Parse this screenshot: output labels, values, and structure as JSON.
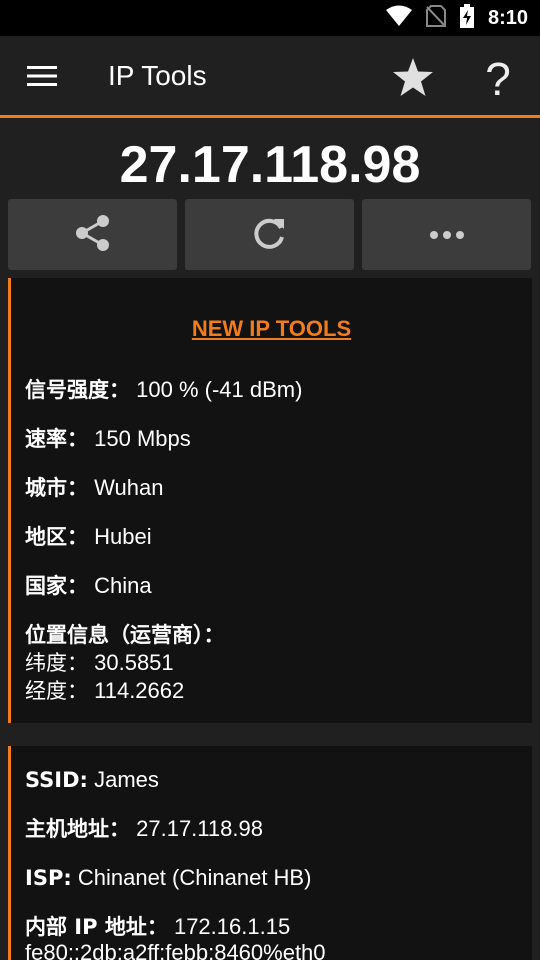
{
  "status_bar": {
    "time": "8:10",
    "icons": [
      "wifi-icon",
      "no-sim-icon",
      "battery-charging-icon"
    ]
  },
  "app_bar": {
    "title": "IP Tools",
    "help_glyph": "?",
    "icons": [
      "menu-icon",
      "star-icon"
    ]
  },
  "ip_address": "27.17.118.98",
  "actions": [
    {
      "name": "share-icon"
    },
    {
      "name": "refresh-icon"
    },
    {
      "name": "more-icon"
    }
  ],
  "accent_color": "#f07c1d",
  "card1": {
    "link": "NEW IP TOOLS",
    "signal": {
      "label": "信号强度：",
      "value": "100 % (-41 dBm)"
    },
    "speed": {
      "label": "速率：",
      "value": "150 Mbps"
    },
    "city": {
      "label": "城市：",
      "value": "Wuhan"
    },
    "region": {
      "label": "地区：",
      "value": "Hubei"
    },
    "country": {
      "label": "国家：",
      "value": "China"
    },
    "location": {
      "label": "位置信息（运营商）：",
      "lat_label": "纬度：",
      "lat_value": "30.5851",
      "lon_label": "经度：",
      "lon_value": "114.2662"
    }
  },
  "card2": {
    "ssid": {
      "label": "SSID:",
      "value": "James"
    },
    "host": {
      "label": "主机地址：",
      "value": "27.17.118.98"
    },
    "isp": {
      "label": "ISP:",
      "value": "Chinanet (Chinanet HB)"
    },
    "internal": {
      "label": "内部 IP 地址：",
      "value": "172.16.1.15",
      "ipv6": "fe80::2db:a2ff:febb:8460%eth0"
    }
  }
}
